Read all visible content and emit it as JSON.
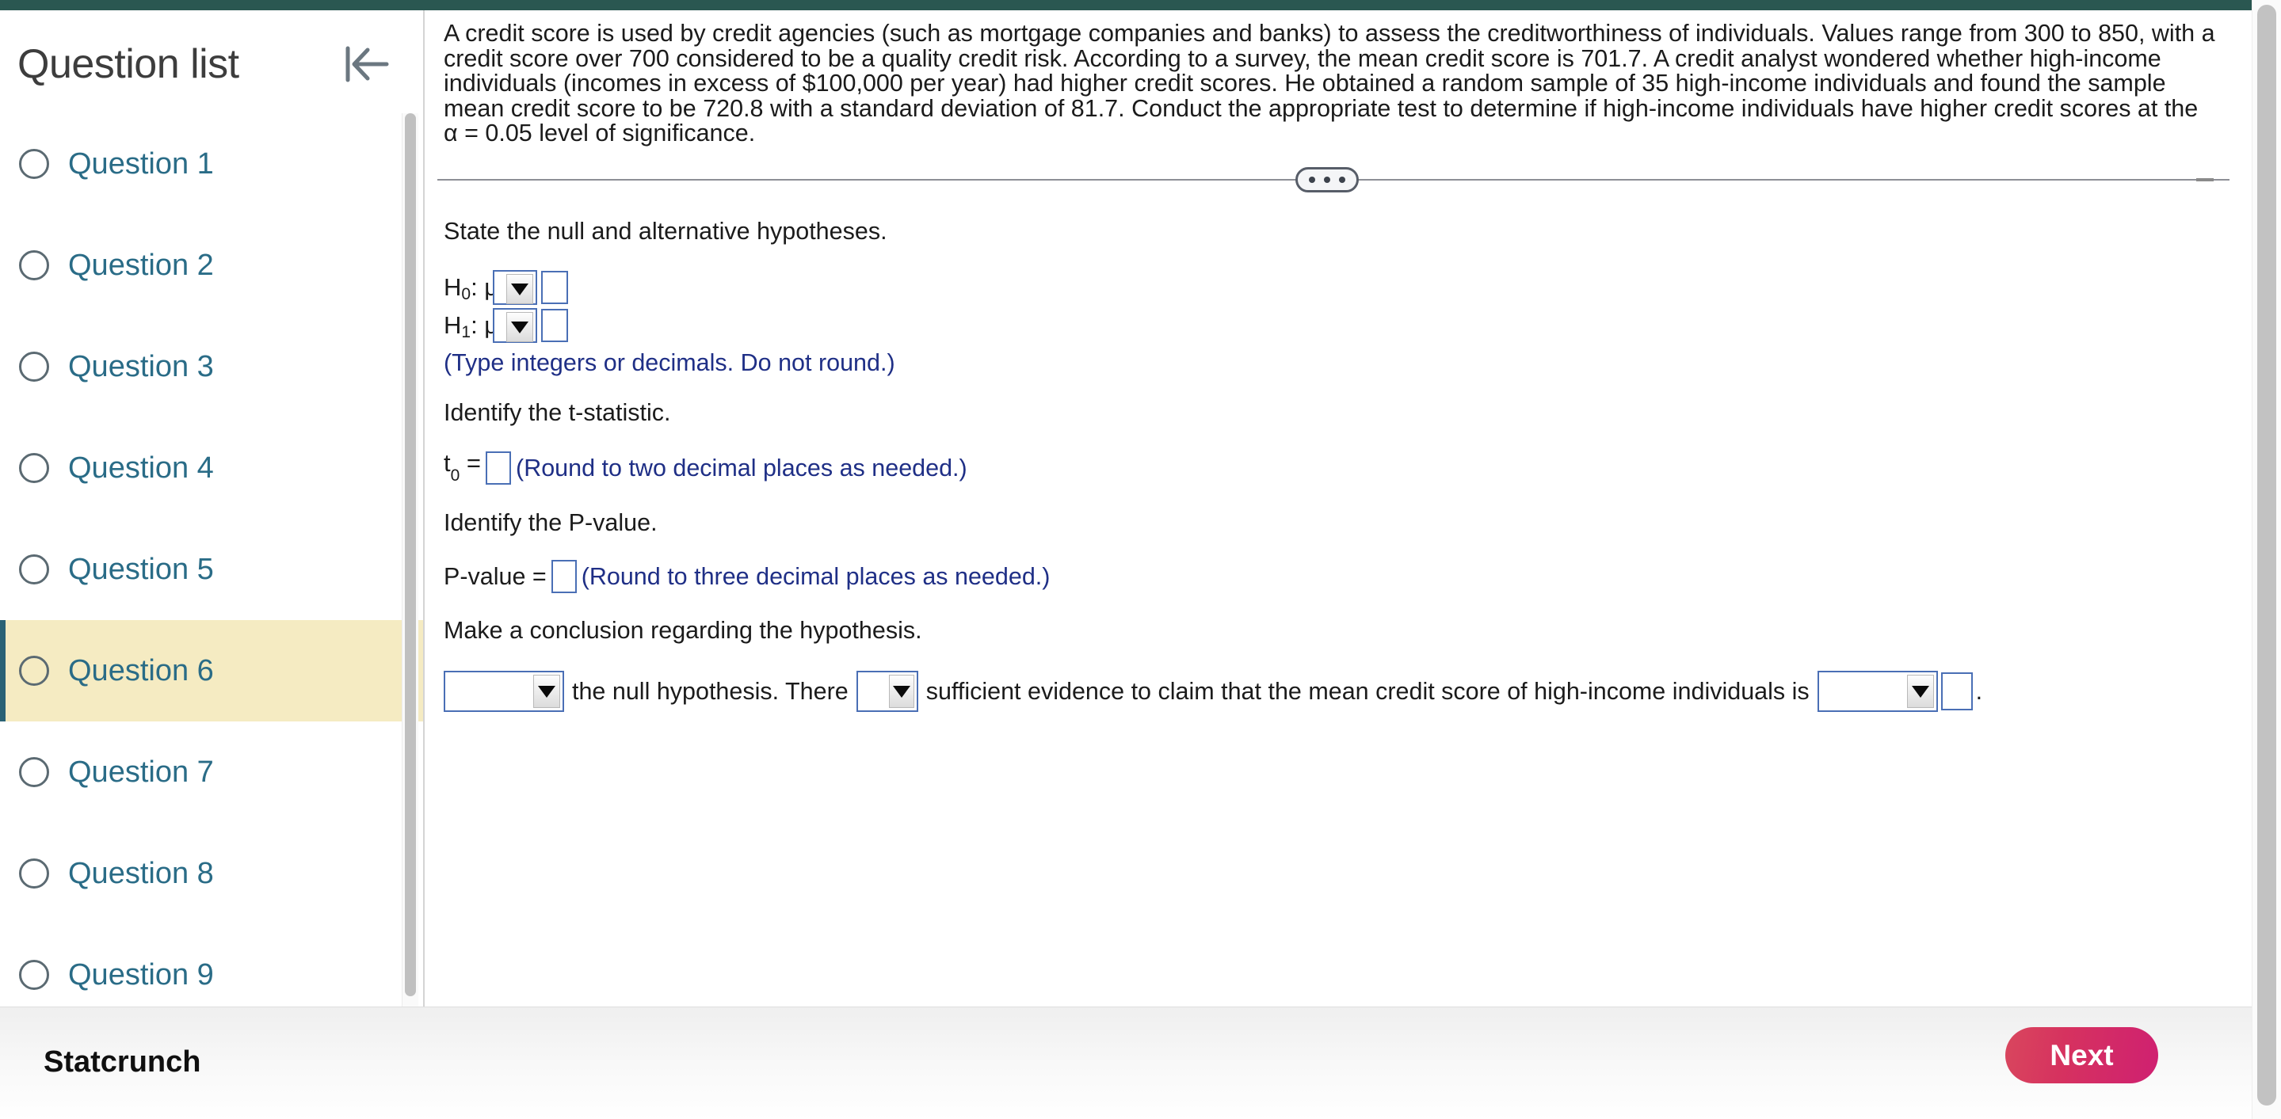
{
  "top_bar": {
    "color": "#2a5751"
  },
  "sidebar": {
    "title": "Question list",
    "collapse_icon": "collapse-left-icon",
    "items": [
      {
        "label": "Question 1",
        "active": false
      },
      {
        "label": "Question 2",
        "active": false
      },
      {
        "label": "Question 3",
        "active": false
      },
      {
        "label": "Question 4",
        "active": false
      },
      {
        "label": "Question 5",
        "active": false
      },
      {
        "label": "Question 6",
        "active": true
      },
      {
        "label": "Question 7",
        "active": false
      },
      {
        "label": "Question 8",
        "active": false
      },
      {
        "label": "Question 9",
        "active": false
      }
    ],
    "active_highlight_color": "#f5ebc2",
    "active_border_color": "#2a6275",
    "link_color": "#2a6c87"
  },
  "main": {
    "problem_statement": "A credit score is used by credit agencies (such as mortgage companies and banks) to assess the creditworthiness of individuals. Values range from 300 to 850, with a credit score over 700 considered to be a quality credit risk. According to a survey, the mean credit score is 701.7. A credit analyst wondered whether high-income individuals (incomes in excess of $100,000 per year) had higher credit scores. He obtained a random sample of 35 high-income individuals and found the sample mean credit score to be 720.8 with a standard deviation of 81.7. Conduct the appropriate test to determine if high-income individuals have higher credit scores at the α = 0.05 level of significance.",
    "divider_handle_icon": "drag-handle-dots-icon",
    "prompt_hypotheses": "State the null and alternative hypotheses.",
    "h0_label": "H",
    "h0_sub": "0",
    "h0_colon_mu": ": μ",
    "h1_label": "H",
    "h1_sub": "1",
    "h1_colon_mu": ": μ",
    "h0_operator_value": "",
    "h0_value": "",
    "h1_operator_value": "",
    "h1_value": "",
    "hypotheses_note": "(Type integers or decimals. Do not round.)",
    "prompt_tstat": "Identify the t-statistic.",
    "t_label": "t",
    "t_sub": "0",
    "t_equals": " = ",
    "t_value": "",
    "t_note": "(Round to two decimal places as needed.)",
    "prompt_pvalue": "Identify the P-value.",
    "p_label": "P-value = ",
    "p_value": "",
    "p_note": "(Round to three decimal places as needed.)",
    "prompt_conclusion": "Make a conclusion regarding the hypothesis.",
    "conclusion_select_1_value": "",
    "conclusion_text_1": "the null hypothesis. There",
    "conclusion_select_2_value": "",
    "conclusion_text_2": "sufficient evidence to claim that the mean credit score of high-income individuals is",
    "conclusion_select_3_value": "",
    "conclusion_final_value": "",
    "conclusion_period": ".",
    "note_color": "#1f2f86",
    "input_border_color": "#4a6fb5"
  },
  "bottom_bar": {
    "statcrunch_label": "Statcrunch",
    "next_label": "Next",
    "next_color_start": "#d9475e",
    "next_color_end": "#cf2071"
  }
}
